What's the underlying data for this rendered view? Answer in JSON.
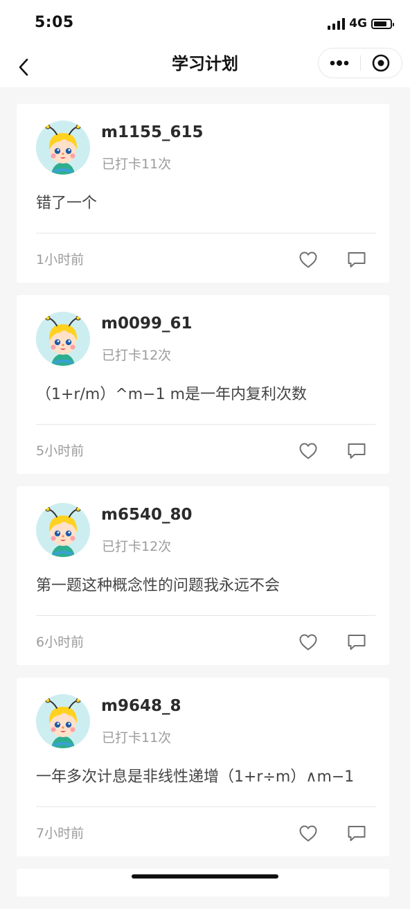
{
  "status_bar": {
    "time": "5:05",
    "network": "4G",
    "battery_level": 0.8,
    "signal_bars": 4
  },
  "nav": {
    "title": "学习计划",
    "back_icon": "chevron-left-icon",
    "more_icon": "more-dots-icon",
    "close_icon": "target-circle-icon"
  },
  "posts": [
    {
      "username": "m1155_615",
      "checkin": "已打卡11次",
      "content": "错了一个",
      "time": "1小时前"
    },
    {
      "username": "m0099_61",
      "checkin": "已打卡12次",
      "content": "（1+r/m）^m−1 m是一年内复利次数",
      "time": "5小时前"
    },
    {
      "username": "m6540_80",
      "checkin": "已打卡12次",
      "content": "第一题这种概念性的问题我永远不会",
      "time": "6小时前"
    },
    {
      "username": "m9648_8",
      "checkin": "已打卡11次",
      "content": "一年多次计息是非线性递增（1+r÷m）∧m−1",
      "time": "7小时前"
    }
  ],
  "colors": {
    "background": "#f6f6f6",
    "card": "#ffffff",
    "muted_text": "#9b9b9b",
    "avatar_bg": "#cdeef0"
  }
}
